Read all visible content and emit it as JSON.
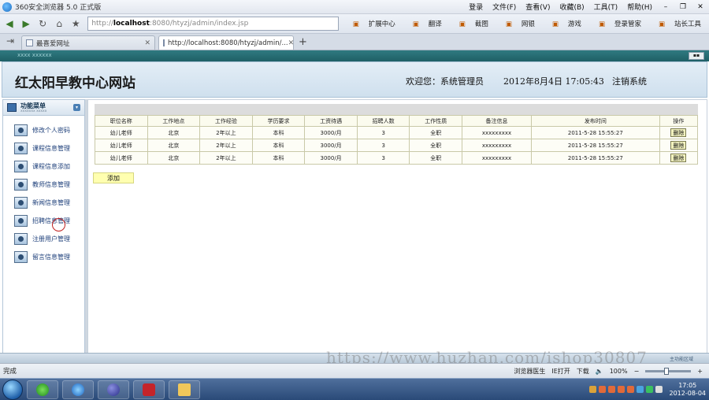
{
  "browser": {
    "title": "360安全浏览器 5.0 正式版",
    "menus": [
      "登录",
      "文件(F)",
      "查看(V)",
      "收藏(B)",
      "工具(T)",
      "帮助(H)"
    ],
    "address": {
      "scheme": "http://",
      "host": "localhost",
      "path": ":8080/htyzj/admin/index.jsp"
    },
    "tools": [
      "扩展中心",
      "翻译",
      "截图",
      "网银",
      "游戏",
      "登录管家",
      "站长工具"
    ],
    "tabs": [
      {
        "label": "最喜爱网址"
      },
      {
        "label": "http://localhost:8080/htyzj/admin/..."
      }
    ],
    "status": {
      "left": "完成",
      "mode": "浏览器医生",
      "open": "IE打开",
      "download": "下载",
      "zoom": "100%"
    }
  },
  "page": {
    "strip_text": "xxxx xxxxxx",
    "site_title": "红太阳早教中心网站",
    "welcome": "欢迎您：系统管理员",
    "datetime": "2012年8月4日  17:05:43",
    "logout": "注销系统",
    "sidebar": {
      "title": "功能菜单",
      "subtitle": "xxxxxxx xxxxx",
      "items": [
        {
          "label": "修改个人密码"
        },
        {
          "label": "课程信息管理"
        },
        {
          "label": "课程信息添加"
        },
        {
          "label": "教师信息管理"
        },
        {
          "label": "新闻信息管理"
        },
        {
          "label": "招聘信息管理"
        },
        {
          "label": "注册用户管理"
        },
        {
          "label": "留言信息管理"
        }
      ]
    },
    "table": {
      "headers": [
        "职位名称",
        "工作地点",
        "工作经验",
        "学历要求",
        "工资待遇",
        "招聘人数",
        "工作性质",
        "备注信息",
        "发布时间",
        "操作"
      ],
      "rows": [
        [
          "幼儿老师",
          "北京",
          "2年以上",
          "本科",
          "3000/月",
          "3",
          "全职",
          "xxxxxxxxx",
          "2011-5-28 15:55:27",
          "删除"
        ],
        [
          "幼儿老师",
          "北京",
          "2年以上",
          "本科",
          "3000/月",
          "3",
          "全职",
          "xxxxxxxxx",
          "2011-5-28 15:55:27",
          "删除"
        ],
        [
          "幼儿老师",
          "北京",
          "2年以上",
          "本科",
          "3000/月",
          "3",
          "全职",
          "xxxxxxxxx",
          "2011-5-28 15:55:27",
          "删除"
        ]
      ]
    },
    "add_label": "添加",
    "bottom_text": "主功能区域",
    "watermark": "https://www.huzhan.com/ishop30807"
  },
  "taskbar": {
    "time": "17:05",
    "date": "2012-08-04"
  }
}
